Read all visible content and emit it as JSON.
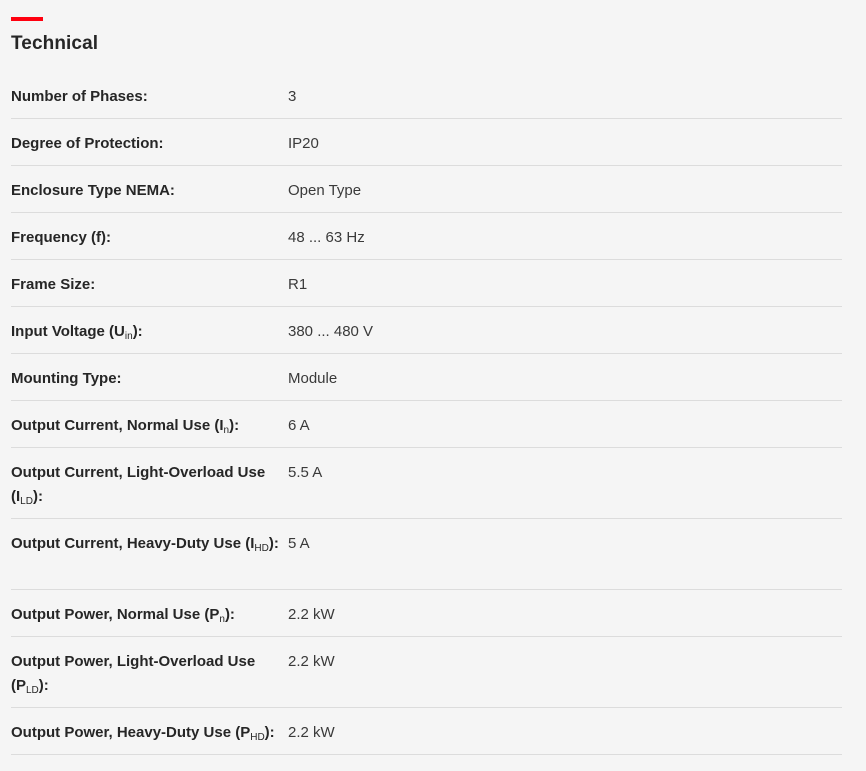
{
  "section": {
    "title": "Technical",
    "accent_color": "#ff000f"
  },
  "specs": [
    {
      "label_main": "Number of Phases:",
      "label_sub": "",
      "label_tail": "",
      "value": "3"
    },
    {
      "label_main": "Degree of Protection:",
      "label_sub": "",
      "label_tail": "",
      "value": "IP20"
    },
    {
      "label_main": "Enclosure Type NEMA:",
      "label_sub": "",
      "label_tail": "",
      "value": "Open Type"
    },
    {
      "label_main": "Frequency (f):",
      "label_sub": "",
      "label_tail": "",
      "value": "48 ... 63 Hz"
    },
    {
      "label_main": "Frame Size:",
      "label_sub": "",
      "label_tail": "",
      "value": "R1"
    },
    {
      "label_main": "Input Voltage (U",
      "label_sub": "in",
      "label_tail": "):",
      "value": "380 ... 480 V"
    },
    {
      "label_main": "Mounting Type:",
      "label_sub": "",
      "label_tail": "",
      "value": "Module"
    },
    {
      "label_main": "Output Current, Normal Use (I",
      "label_sub": "n",
      "label_tail": "):",
      "value": "6 A"
    },
    {
      "label_main": "Output Current, Light-Overload Use (I",
      "label_sub": "LD",
      "label_tail": "):",
      "value": "5.5 A"
    },
    {
      "label_main": "Output Current, Heavy-Duty Use (I",
      "label_sub": "HD",
      "label_tail": "):",
      "value": "5 A"
    },
    {
      "label_main": "Output Power, Normal Use (P",
      "label_sub": "n",
      "label_tail": "):",
      "value": "2.2 kW"
    },
    {
      "label_main": "Output Power, Light-Overload Use (P",
      "label_sub": "LD",
      "label_tail": "):",
      "value": "2.2 kW"
    },
    {
      "label_main": "Output Power, Heavy-Duty Use (P",
      "label_sub": "HD",
      "label_tail": "):",
      "value": "2.2 kW"
    }
  ]
}
